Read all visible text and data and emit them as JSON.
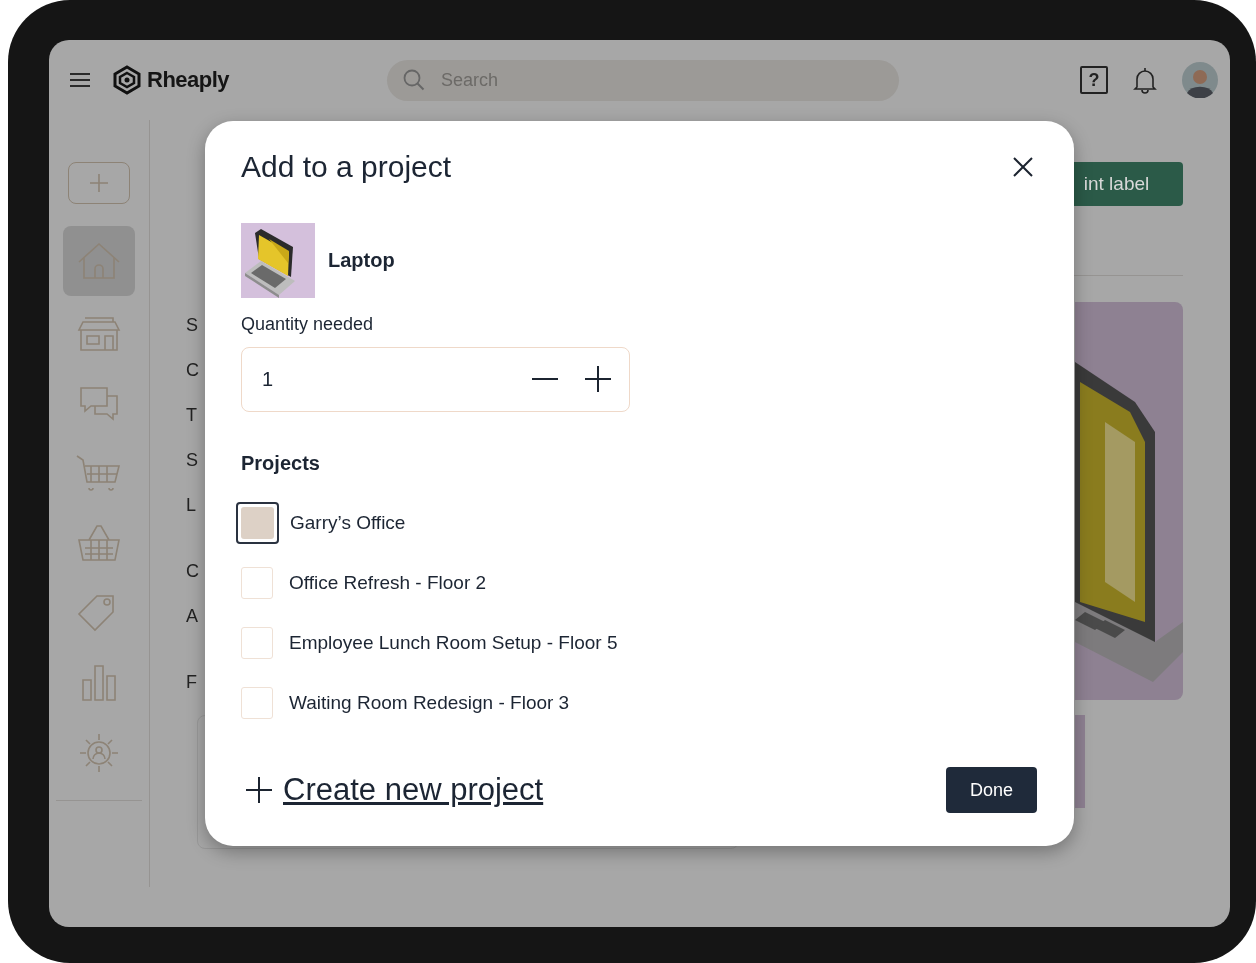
{
  "topbar": {
    "brand": "Rheaply",
    "search": {
      "placeholder": "Search"
    },
    "help_label": "?"
  },
  "sidebar": {
    "items": [
      {
        "selected": false
      },
      {
        "selected": true
      },
      {
        "selected": false
      },
      {
        "selected": false
      },
      {
        "selected": false
      },
      {
        "selected": false
      },
      {
        "selected": false
      },
      {
        "selected": false
      },
      {
        "selected": false
      }
    ]
  },
  "background": {
    "button_label": "int label",
    "row_labels": [
      "S",
      "C",
      "T",
      "S",
      "L",
      "C",
      "A",
      "F"
    ]
  },
  "dialog": {
    "title": "Add to a project",
    "item": {
      "name": "Laptop"
    },
    "quantity": {
      "label": "Quantity needed",
      "value": "1"
    },
    "projects": {
      "heading": "Projects",
      "items": [
        {
          "name": "Garry’s Office",
          "checked": false,
          "focused": true
        },
        {
          "name": "Office Refresh - Floor 2",
          "checked": false,
          "focused": false
        },
        {
          "name": "Employee Lunch Room Setup - Floor 5",
          "checked": false,
          "focused": false
        },
        {
          "name": "Waiting Room Redesign - Floor 3",
          "checked": false,
          "focused": false
        }
      ]
    },
    "create_link": "Create new project",
    "done_button": "Done"
  }
}
